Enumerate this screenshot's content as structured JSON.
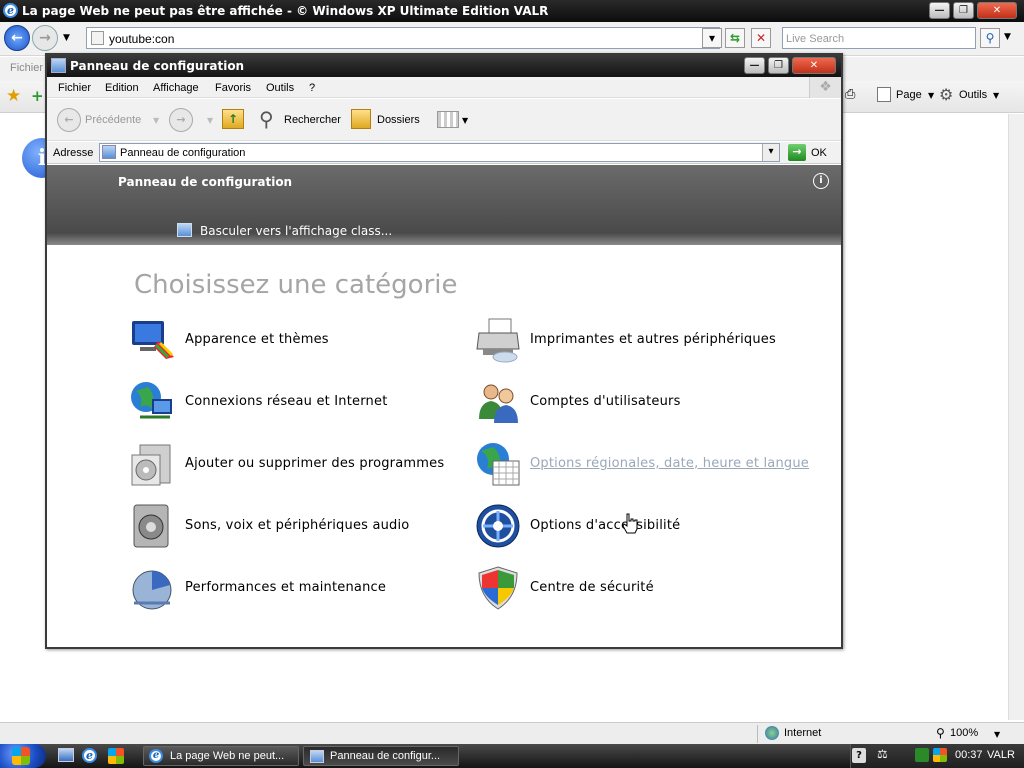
{
  "ie": {
    "title": "La page Web ne peut pas être affichée - © Windows XP Ultimate Edition VALR",
    "address": "youtube:con",
    "search_placeholder": "Live Search",
    "menu_fichier": "Fichier",
    "toolbar_page": "Page",
    "toolbar_outils": "Outils",
    "status_zone": "Internet",
    "zoom": "100%"
  },
  "cp": {
    "title": "Panneau de configuration",
    "menu": [
      "Fichier",
      "Edition",
      "Affichage",
      "Favoris",
      "Outils",
      "?"
    ],
    "toolbar": {
      "back": "Précédente",
      "search": "Rechercher",
      "folders": "Dossiers"
    },
    "address_label": "Adresse",
    "address_value": "Panneau de configuration",
    "go": "OK",
    "header_title": "Panneau de configuration",
    "switch_view": "Basculer vers l'affichage class...",
    "heading": "Choisissez une catégorie",
    "categories": [
      {
        "label": "Apparence et thèmes",
        "icon": "appearance-icon"
      },
      {
        "label": "Imprimantes et autres périphériques",
        "icon": "printer-icon"
      },
      {
        "label": "Connexions réseau et Internet",
        "icon": "network-icon"
      },
      {
        "label": "Comptes d'utilisateurs",
        "icon": "users-icon"
      },
      {
        "label": "Ajouter ou supprimer des programmes",
        "icon": "programs-icon"
      },
      {
        "label": "Options régionales, date, heure et langue",
        "icon": "regional-icon",
        "hovered": true
      },
      {
        "label": "Sons, voix et périphériques audio",
        "icon": "speaker-icon"
      },
      {
        "label": "Options d'accessibilité",
        "icon": "accessibility-icon"
      },
      {
        "label": "Performances et maintenance",
        "icon": "performance-icon"
      },
      {
        "label": "Centre de sécurité",
        "icon": "security-shield-icon"
      }
    ]
  },
  "taskbar": {
    "tasks": [
      "La page Web ne peut...",
      "Panneau de configur..."
    ],
    "clock": "00:37",
    "user": "VALR"
  },
  "colors": {
    "hover_link": "#9aa8b8",
    "heading": "#a5a5a5"
  }
}
